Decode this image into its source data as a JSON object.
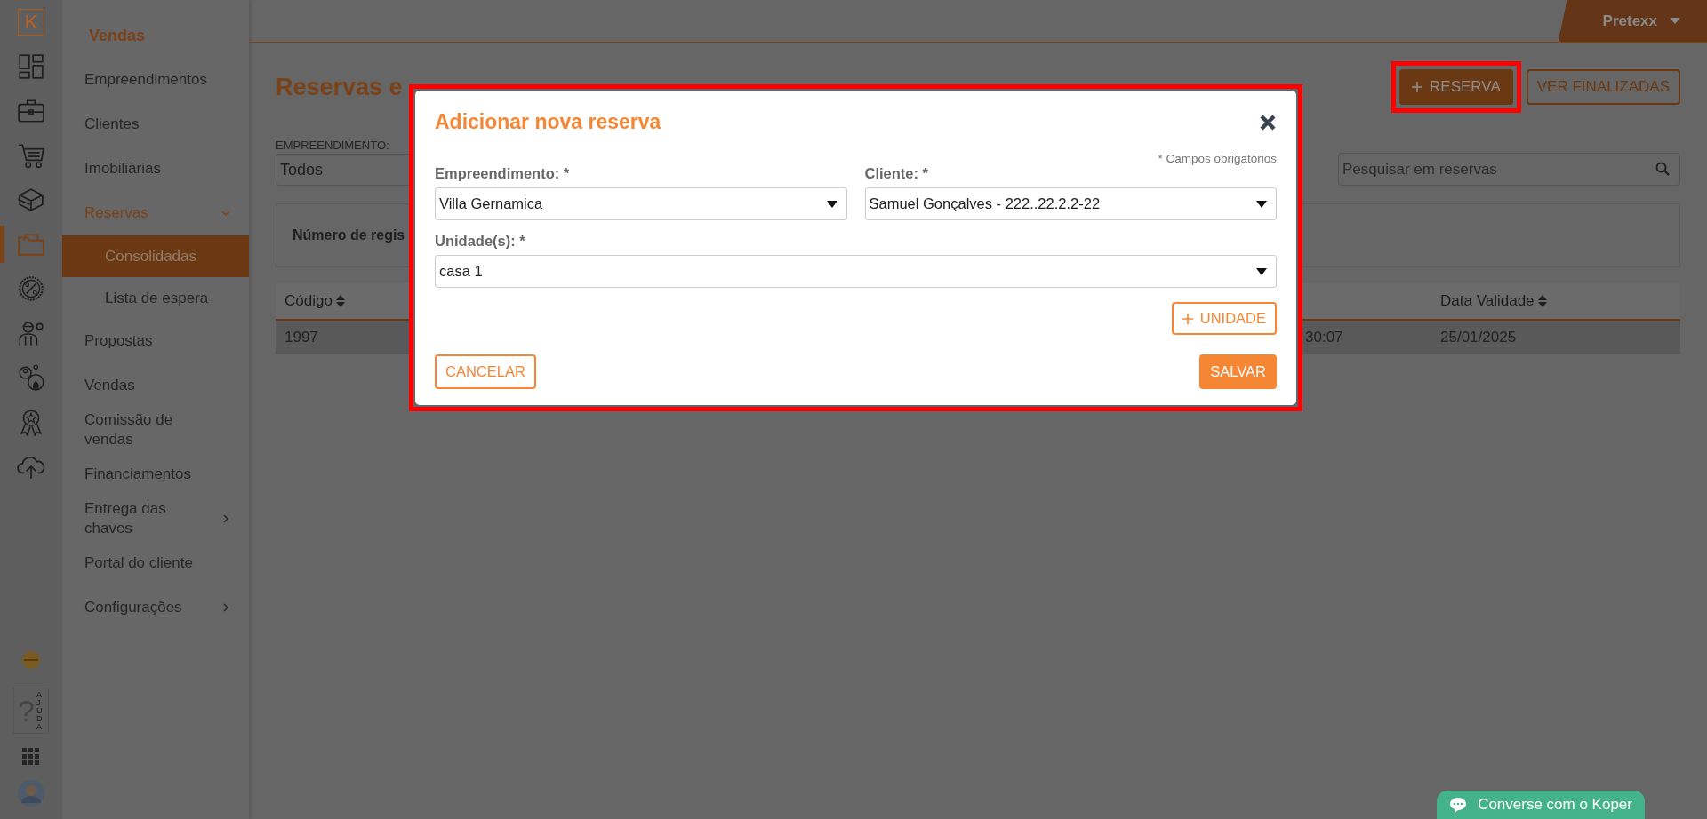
{
  "rail": {
    "logo": "K",
    "items": [
      {
        "selected": false
      },
      {
        "selected": false
      },
      {
        "selected": false
      },
      {
        "selected": false
      },
      {
        "selected": true
      },
      {
        "selected": false
      },
      {
        "selected": false
      },
      {
        "selected": false
      },
      {
        "selected": false
      },
      {
        "selected": false
      }
    ],
    "help_mark": "?",
    "help_label": "AJUDA"
  },
  "header": {
    "user": "Pretexx"
  },
  "sidebar": {
    "title": "Vendas",
    "items": [
      {
        "label": "Empreendimentos",
        "kind": "link",
        "selected": false
      },
      {
        "label": "Clientes",
        "kind": "link",
        "selected": false
      },
      {
        "label": "Imobiliárias",
        "kind": "link",
        "selected": false
      },
      {
        "label": "Reservas",
        "kind": "group",
        "selected": true,
        "expanded": true,
        "children": [
          {
            "label": "Consolidadas",
            "selected": true
          },
          {
            "label": "Lista de espera",
            "selected": false
          }
        ]
      },
      {
        "label": "Propostas",
        "kind": "link",
        "selected": false
      },
      {
        "label": "Vendas",
        "kind": "link",
        "selected": false
      },
      {
        "label": "Comissão de vendas",
        "kind": "link",
        "selected": false
      },
      {
        "label": "Financiamentos",
        "kind": "link",
        "selected": false
      },
      {
        "label": "Entrega das chaves",
        "kind": "group",
        "selected": false,
        "expanded": false
      },
      {
        "label": "Portal do cliente",
        "kind": "link",
        "selected": false
      },
      {
        "label": "Configurações",
        "kind": "group",
        "selected": false,
        "expanded": false
      }
    ]
  },
  "page": {
    "title": "Reservas e",
    "buttons": [
      {
        "label": "RESERVA",
        "kind": "primary",
        "highlighted": true
      },
      {
        "label": "VER FINALIZADAS",
        "kind": "outline",
        "highlighted": false
      }
    ],
    "filter": {
      "label": "EMPREENDIMENTO:",
      "value": "Todos"
    },
    "search": {
      "placeholder": "Pesquisar em reservas"
    },
    "info": "Número de regis",
    "table": {
      "columns": [
        {
          "label": "Código",
          "sortable": true
        },
        {
          "sortable": false
        },
        {
          "label": "Data Validade",
          "sortable": true
        }
      ],
      "rows": [
        {
          "cells": [
            "1997",
            "30:07",
            "25/01/2025"
          ]
        }
      ]
    }
  },
  "modal": {
    "title": "Adicionar nova reserva",
    "highlighted": true,
    "required_note": "* Campos obrigatórios",
    "fields": [
      {
        "label": "Empreendimento: *",
        "value": "Villa Gernamica",
        "kind": "half"
      },
      {
        "label": "Cliente: *",
        "value": "Samuel Gonçalves - 222..22.2.2-22",
        "kind": "half"
      },
      {
        "label": "Unidade(s): *",
        "value": "casa 1",
        "kind": "full"
      }
    ],
    "add_button": "UNIDADE",
    "cancel": "CANCELAR",
    "save": "SALVAR"
  },
  "chat": {
    "label": "Converse com o Koper"
  }
}
